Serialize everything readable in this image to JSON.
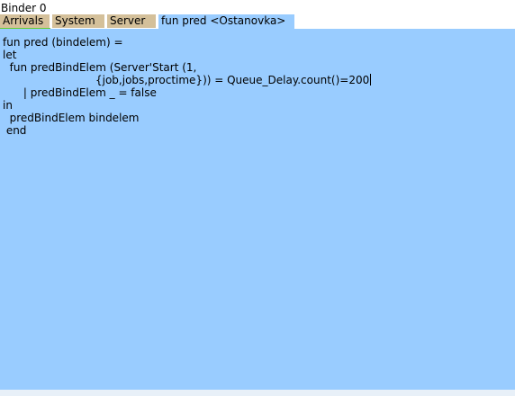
{
  "window": {
    "title": "Binder 0"
  },
  "tabs": [
    {
      "label": "Arrivals",
      "active": false
    },
    {
      "label": "System",
      "active": false
    },
    {
      "label": "Server",
      "active": false
    },
    {
      "label": "fun pred <Ostanovka>",
      "active": true
    }
  ],
  "editor": {
    "lines": [
      "fun pred (bindelem) =",
      "let",
      "  fun predBindElem (Server'Start (1,",
      "                           {job,jobs,proctime})) = Queue_Delay.count()=200",
      "      | predBindElem _ = false",
      "in",
      "  predBindElem bindelem",
      " end"
    ]
  },
  "colors": {
    "editor_background": "#99ccff",
    "inactive_tab": "#d4c09a",
    "active_tab": "#99ccff",
    "tab_indicator": "#66cc33"
  }
}
